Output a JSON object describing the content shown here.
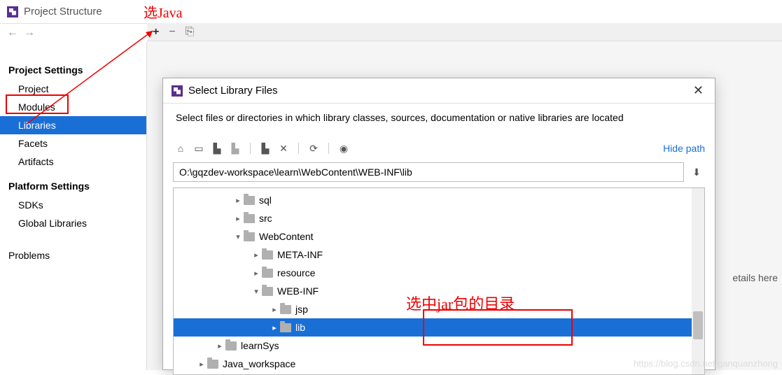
{
  "title": "Project Structure",
  "annotations": {
    "top": "选Java",
    "mid": "选中jar包的目录"
  },
  "sidebar": {
    "sections": [
      {
        "header": "Project Settings",
        "items": [
          "Project",
          "Modules",
          "Libraries",
          "Facets",
          "Artifacts"
        ],
        "selected": 2
      },
      {
        "header": "Platform Settings",
        "items": [
          "SDKs",
          "Global Libraries"
        ]
      }
    ],
    "problems": "Problems"
  },
  "details_hint": "etails here",
  "dialog": {
    "title": "Select Library Files",
    "description": "Select files or directories in which library classes, sources, documentation or native libraries are located",
    "hide_path": "Hide path",
    "path": "O:\\gqzdev-workspace\\learn\\WebContent\\WEB-INF\\lib",
    "tree": [
      {
        "indent": 3,
        "chevron": "right",
        "label": "sql"
      },
      {
        "indent": 3,
        "chevron": "right",
        "label": "src"
      },
      {
        "indent": 3,
        "chevron": "down",
        "label": "WebContent"
      },
      {
        "indent": 4,
        "chevron": "right",
        "label": "META-INF"
      },
      {
        "indent": 4,
        "chevron": "right",
        "label": "resource"
      },
      {
        "indent": 4,
        "chevron": "down",
        "label": "WEB-INF"
      },
      {
        "indent": 5,
        "chevron": "right",
        "label": "jsp"
      },
      {
        "indent": 5,
        "chevron": "right",
        "label": "lib",
        "selected": true
      },
      {
        "indent": 2,
        "chevron": "right",
        "label": "learnSys"
      },
      {
        "indent": 1,
        "chevron": "right",
        "label": "Java_workspace"
      }
    ]
  },
  "watermark": "https://blog.csdn.net/ganquanzhong"
}
